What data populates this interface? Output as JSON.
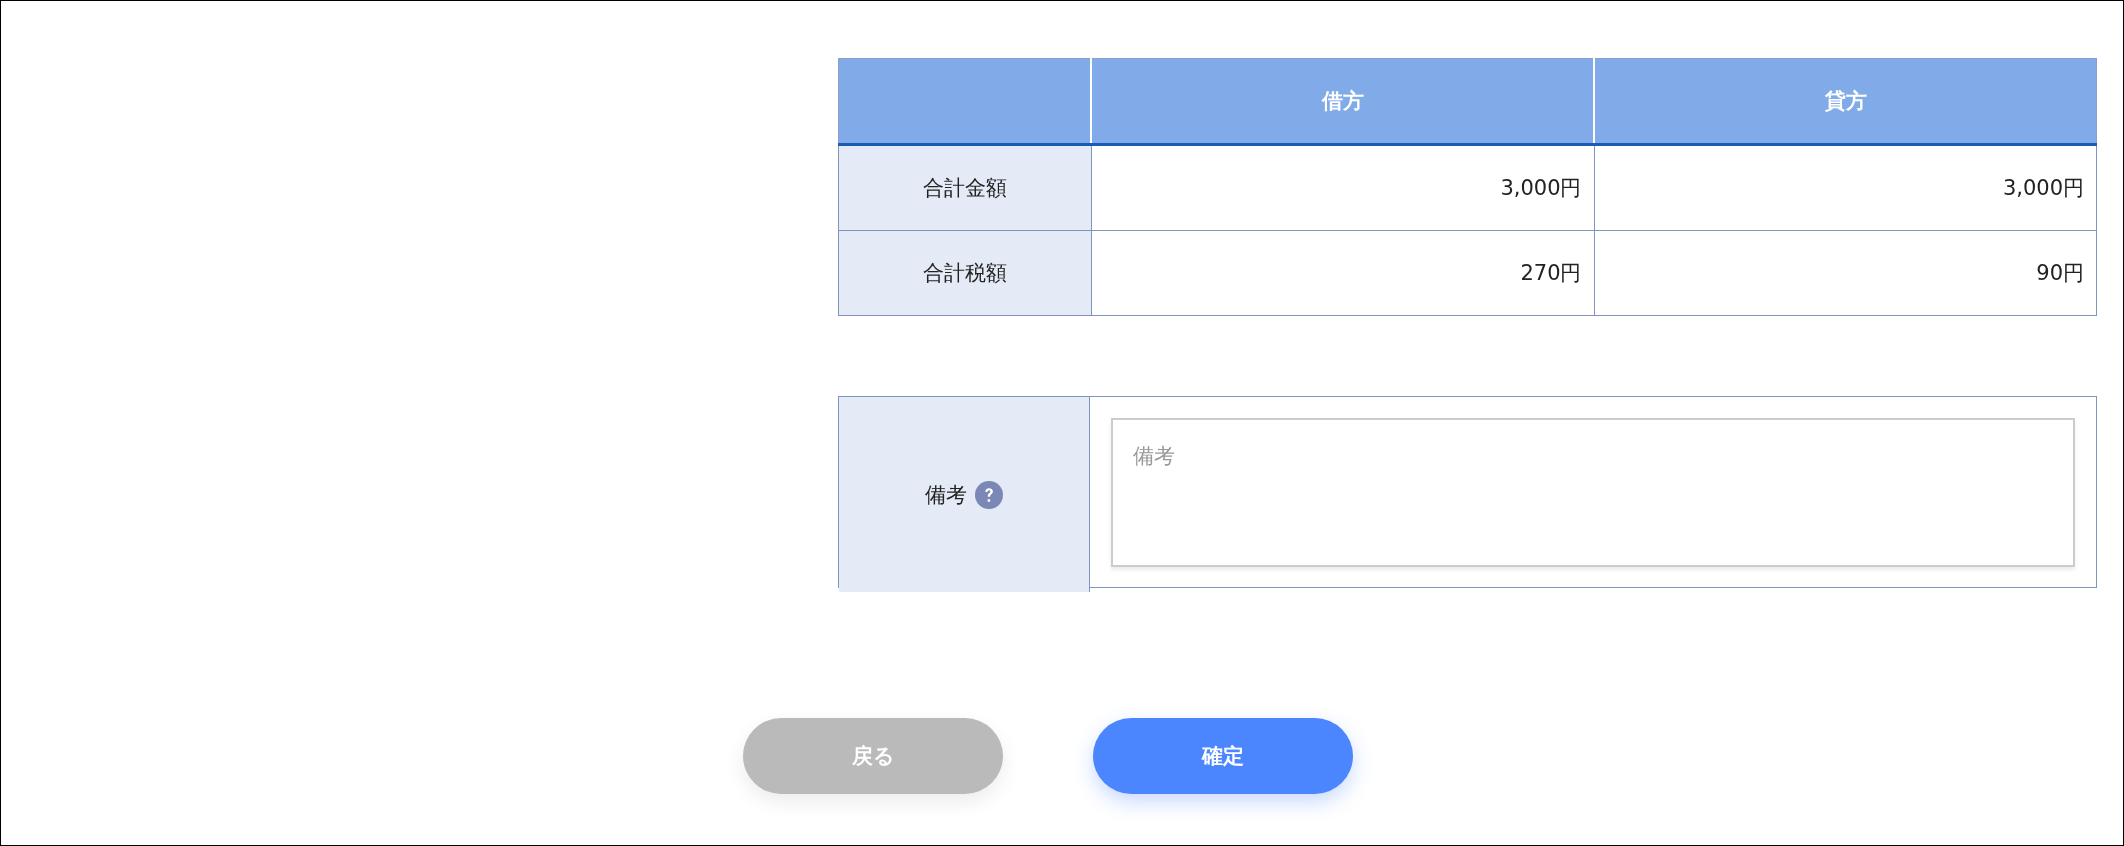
{
  "totals_table": {
    "columns": [
      "",
      "借方",
      "貸方"
    ],
    "rows": [
      {
        "label": "合計金額",
        "debit": "3,000円",
        "credit": "3,000円"
      },
      {
        "label": "合計税額",
        "debit": "270円",
        "credit": "90円"
      }
    ]
  },
  "remarks": {
    "label": "備考",
    "placeholder": "備考"
  },
  "buttons": [
    {
      "label": "戻る",
      "kind": "secondary"
    },
    {
      "label": "確定",
      "kind": "primary"
    }
  ]
}
